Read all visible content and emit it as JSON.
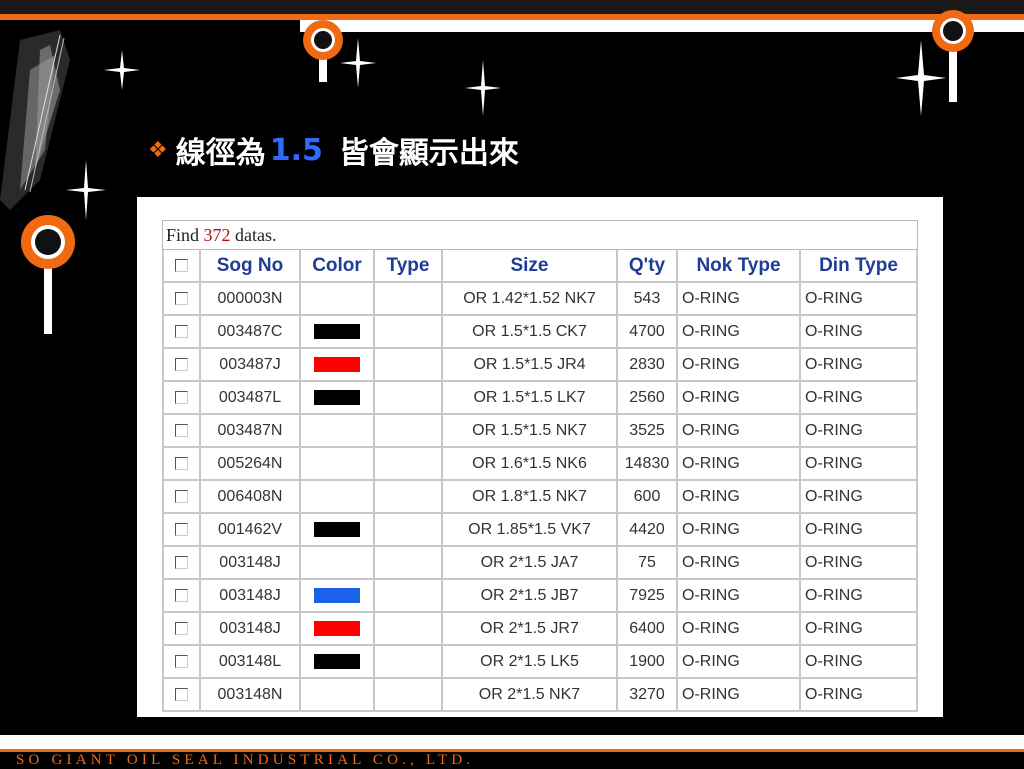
{
  "slide": {
    "title_prefix": "線徑為",
    "title_number": "1.5",
    "title_suffix": "皆會顯示出來",
    "bullet": "❖",
    "footer": "SO GIANT OIL SEAL INDUSTRIAL CO., LTD."
  },
  "result": {
    "find_prefix": "Find ",
    "count": "372",
    "find_suffix": " datas."
  },
  "columns": [
    "",
    "Sog No",
    "Color",
    "Type",
    "Size",
    "Q'ty",
    "Nok Type",
    "Din Type"
  ],
  "rows": [
    {
      "sog": "000003N",
      "color": "",
      "type": "",
      "size": "OR 1.42*1.52 NK7",
      "qty": "543",
      "nok": "O-RING",
      "din": "O-RING"
    },
    {
      "sog": "003487C",
      "color": "#000000",
      "type": "",
      "size": "OR 1.5*1.5 CK7",
      "qty": "4700",
      "nok": "O-RING",
      "din": "O-RING"
    },
    {
      "sog": "003487J",
      "color": "#ff0000",
      "type": "",
      "size": "OR 1.5*1.5 JR4",
      "qty": "2830",
      "nok": "O-RING",
      "din": "O-RING"
    },
    {
      "sog": "003487L",
      "color": "#000000",
      "type": "",
      "size": "OR 1.5*1.5 LK7",
      "qty": "2560",
      "nok": "O-RING",
      "din": "O-RING"
    },
    {
      "sog": "003487N",
      "color": "",
      "type": "",
      "size": "OR 1.5*1.5 NK7",
      "qty": "3525",
      "nok": "O-RING",
      "din": "O-RING"
    },
    {
      "sog": "005264N",
      "color": "",
      "type": "",
      "size": "OR 1.6*1.5 NK6",
      "qty": "14830",
      "nok": "O-RING",
      "din": "O-RING"
    },
    {
      "sog": "006408N",
      "color": "",
      "type": "",
      "size": "OR 1.8*1.5 NK7",
      "qty": "600",
      "nok": "O-RING",
      "din": "O-RING"
    },
    {
      "sog": "001462V",
      "color": "#000000",
      "type": "",
      "size": "OR 1.85*1.5 VK7",
      "qty": "4420",
      "nok": "O-RING",
      "din": "O-RING"
    },
    {
      "sog": "003148J",
      "color": "",
      "type": "",
      "size": "OR 2*1.5 JA7",
      "qty": "75",
      "nok": "O-RING",
      "din": "O-RING"
    },
    {
      "sog": "003148J",
      "color": "#1a63e8",
      "type": "",
      "size": "OR 2*1.5 JB7",
      "qty": "7925",
      "nok": "O-RING",
      "din": "O-RING"
    },
    {
      "sog": "003148J",
      "color": "#ff0000",
      "type": "",
      "size": "OR 2*1.5 JR7",
      "qty": "6400",
      "nok": "O-RING",
      "din": "O-RING"
    },
    {
      "sog": "003148L",
      "color": "#000000",
      "type": "",
      "size": "OR 2*1.5 LK5",
      "qty": "1900",
      "nok": "O-RING",
      "din": "O-RING"
    },
    {
      "sog": "003148N",
      "color": "",
      "type": "",
      "size": "OR 2*1.5 NK7",
      "qty": "3270",
      "nok": "O-RING",
      "din": "O-RING"
    }
  ],
  "theme": {
    "accent": "#f06a14",
    "header_text": "#1f3c98",
    "count_text": "#b01010"
  }
}
